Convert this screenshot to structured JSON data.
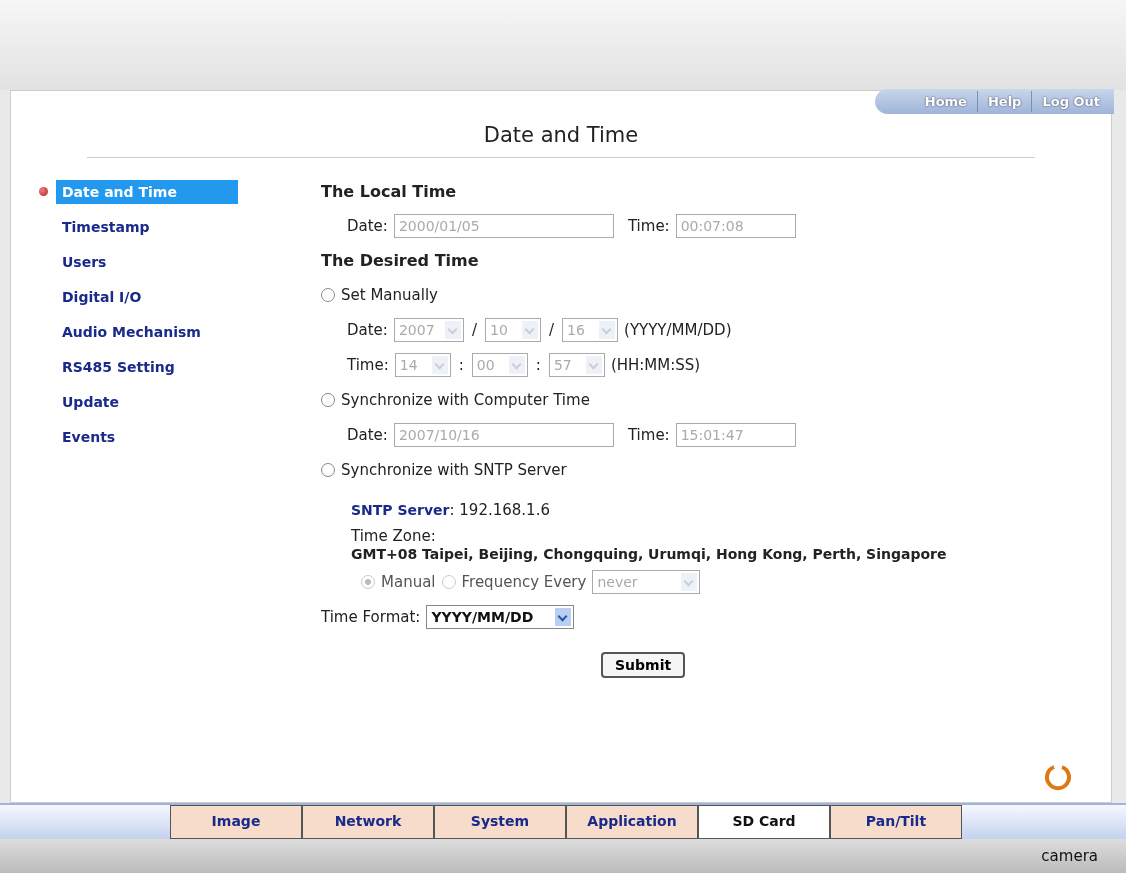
{
  "top_links": [
    "Home",
    "Help",
    "Log Out"
  ],
  "page_title": "Date and Time",
  "sidebar": {
    "items": [
      {
        "label": "Date and Time",
        "selected": true
      },
      {
        "label": "Timestamp",
        "selected": false
      },
      {
        "label": "Users",
        "selected": false
      },
      {
        "label": "Digital I/O",
        "selected": false
      },
      {
        "label": "Audio Mechanism",
        "selected": false
      },
      {
        "label": "RS485 Setting",
        "selected": false
      },
      {
        "label": "Update",
        "selected": false
      },
      {
        "label": "Events",
        "selected": false
      }
    ]
  },
  "local_time": {
    "heading": "The Local Time",
    "date_label": "Date:",
    "date": "2000/01/05",
    "time_label": "Time:",
    "time": "00:07:08"
  },
  "desired_time": {
    "heading": "The Desired Time",
    "set_manually": {
      "label": "Set Manually",
      "selected": false,
      "date_label": "Date:",
      "date_parts": [
        "2007",
        "10",
        "16"
      ],
      "date_sep": "/",
      "date_hint": "(YYYY/MM/DD)",
      "time_label": "Time:",
      "time_parts": [
        "14",
        "00",
        "57"
      ],
      "time_sep": ":",
      "time_hint": "(HH:MM:SS)"
    },
    "sync_computer": {
      "label": "Synchronize with Computer Time",
      "selected": false,
      "date_label": "Date:",
      "date": "2007/10/16",
      "time_label": "Time:",
      "time": "15:01:47"
    },
    "sync_sntp": {
      "label": "Synchronize with SNTP Server",
      "selected": false,
      "server_label": "SNTP Server",
      "server_value": ": 192.168.1.6",
      "timezone_label": "Time Zone:",
      "timezone": "GMT+08 Taipei, Beijing, Chongquing, Urumqi, Hong Kong, Perth, Singapore",
      "modes": [
        {
          "label": "Manual",
          "selected": true,
          "disabled": true
        },
        {
          "label": "Frequency Every",
          "selected": false,
          "disabled": true
        }
      ],
      "frequency": "never"
    }
  },
  "time_format": {
    "label": "Time Format:",
    "value": "YYYY/MM/DD"
  },
  "submit": "Submit",
  "bottom_tabs": [
    {
      "label": "Image",
      "selected": false
    },
    {
      "label": "Network",
      "selected": false
    },
    {
      "label": "System",
      "selected": false
    },
    {
      "label": "Application",
      "selected": false
    },
    {
      "label": "SD Card",
      "selected": true
    },
    {
      "label": "Pan/Tilt",
      "selected": false
    }
  ],
  "footer_brand": "camera"
}
